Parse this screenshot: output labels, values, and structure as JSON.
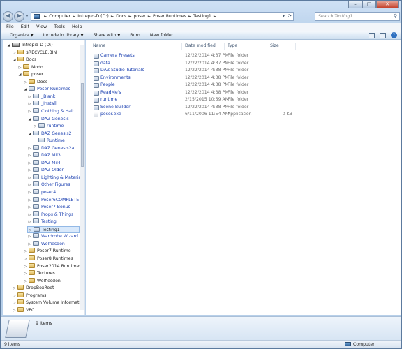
{
  "address": {
    "crumbs": [
      "Computer",
      "Intrepid-D (D:)",
      "Docs",
      "poser",
      "Poser Runtimes",
      "Testing1"
    ]
  },
  "search": {
    "placeholder": "Search Testing1"
  },
  "menu": [
    "File",
    "Edit",
    "View",
    "Tools",
    "Help"
  ],
  "toolbar": {
    "organize": "Organize",
    "include": "Include in library",
    "share": "Share with",
    "burn": "Burn",
    "new_folder": "New folder"
  },
  "tree": [
    {
      "label": "Intrepid-D (D:)",
      "level": 0,
      "arrow": "open",
      "icon": "drive"
    },
    {
      "label": "$RECYCLE.BIN",
      "level": 1,
      "arrow": "closed",
      "icon": "folder"
    },
    {
      "label": "Docs",
      "level": 1,
      "arrow": "open",
      "icon": "folder"
    },
    {
      "label": "Modo",
      "level": 2,
      "arrow": "closed",
      "icon": "folder"
    },
    {
      "label": "poser",
      "level": 2,
      "arrow": "open",
      "icon": "folder"
    },
    {
      "label": "Docs",
      "level": 3,
      "arrow": "closed",
      "icon": "folder"
    },
    {
      "label": "Poser Runtimes",
      "level": 3,
      "arrow": "open",
      "icon": "poser",
      "blue": true
    },
    {
      "label": "_Blank",
      "level": 4,
      "arrow": "closed",
      "icon": "poser",
      "blue": true
    },
    {
      "label": "_Install",
      "level": 4,
      "arrow": "closed",
      "icon": "poser",
      "blue": true
    },
    {
      "label": "Clothing & Hair",
      "level": 4,
      "arrow": "closed",
      "icon": "poser",
      "blue": true
    },
    {
      "label": "DAZ Genesis",
      "level": 4,
      "arrow": "open",
      "icon": "poser",
      "blue": true
    },
    {
      "label": "runtime",
      "level": 5,
      "arrow": "closed",
      "icon": "poser",
      "blue": true
    },
    {
      "label": "DAZ Genesis2",
      "level": 4,
      "arrow": "open",
      "icon": "poser",
      "blue": true
    },
    {
      "label": "Runtime",
      "level": 5,
      "arrow": "none",
      "icon": "poser",
      "blue": true
    },
    {
      "label": "DAZ Genesis2a",
      "level": 4,
      "arrow": "closed",
      "icon": "poser",
      "blue": true
    },
    {
      "label": "DAZ Mil3",
      "level": 4,
      "arrow": "closed",
      "icon": "poser",
      "blue": true
    },
    {
      "label": "DAZ Mil4",
      "level": 4,
      "arrow": "closed",
      "icon": "poser",
      "blue": true
    },
    {
      "label": "DAZ Older",
      "level": 4,
      "arrow": "closed",
      "icon": "poser",
      "blue": true
    },
    {
      "label": "Lighting & Materials",
      "level": 4,
      "arrow": "closed",
      "icon": "poser",
      "blue": true
    },
    {
      "label": "Other Figures",
      "level": 4,
      "arrow": "closed",
      "icon": "poser",
      "blue": true
    },
    {
      "label": "poser4",
      "level": 4,
      "arrow": "closed",
      "icon": "poser",
      "blue": true
    },
    {
      "label": "Poser6COMPLETE",
      "level": 4,
      "arrow": "closed",
      "icon": "poser",
      "blue": true
    },
    {
      "label": "Poser7 Bonus",
      "level": 4,
      "arrow": "closed",
      "icon": "poser",
      "blue": true
    },
    {
      "label": "Props & Things",
      "level": 4,
      "arrow": "closed",
      "icon": "poser",
      "blue": true
    },
    {
      "label": "Testing",
      "level": 4,
      "arrow": "closed",
      "icon": "poser",
      "blue": true
    },
    {
      "label": "Testing1",
      "level": 4,
      "arrow": "closed",
      "icon": "poser",
      "selected": true
    },
    {
      "label": "Wardrobe Wizard",
      "level": 4,
      "arrow": "closed",
      "icon": "poser",
      "blue": true
    },
    {
      "label": "Wolfiesden",
      "level": 4,
      "arrow": "closed",
      "icon": "poser",
      "blue": true
    },
    {
      "label": "Poser7 Runtime",
      "level": 3,
      "arrow": "closed",
      "icon": "folder"
    },
    {
      "label": "Poser8 Runtimes",
      "level": 3,
      "arrow": "closed",
      "icon": "folder"
    },
    {
      "label": "Poser2014 Runtimes",
      "level": 3,
      "arrow": "closed",
      "icon": "folder"
    },
    {
      "label": "Textures",
      "level": 3,
      "arrow": "closed",
      "icon": "folder"
    },
    {
      "label": "Wolfiesden",
      "level": 3,
      "arrow": "closed",
      "icon": "folder"
    },
    {
      "label": "DropBoxRoot",
      "level": 1,
      "arrow": "closed",
      "icon": "folder"
    },
    {
      "label": "Programs",
      "level": 1,
      "arrow": "closed",
      "icon": "folder"
    },
    {
      "label": "System Volume Information",
      "level": 1,
      "arrow": "closed",
      "icon": "folder"
    },
    {
      "label": "VPC",
      "level": 1,
      "arrow": "closed",
      "icon": "folder"
    }
  ],
  "columns": {
    "name": "Name",
    "date": "Date modified",
    "type": "Type",
    "size": "Size"
  },
  "files": [
    {
      "name": "Camera Presets",
      "date": "12/22/2014 4:37 PM",
      "type": "File folder",
      "size": "",
      "icon": "folder"
    },
    {
      "name": "data",
      "date": "12/22/2014 4:37 PM",
      "type": "File folder",
      "size": "",
      "icon": "folder"
    },
    {
      "name": "DAZ Studio Tutorials",
      "date": "12/22/2014 4:38 PM",
      "type": "File folder",
      "size": "",
      "icon": "folder"
    },
    {
      "name": "Environments",
      "date": "12/22/2014 4:38 PM",
      "type": "File folder",
      "size": "",
      "icon": "folder"
    },
    {
      "name": "People",
      "date": "12/22/2014 4:38 PM",
      "type": "File folder",
      "size": "",
      "icon": "folder"
    },
    {
      "name": "ReadMe's",
      "date": "12/22/2014 4:38 PM",
      "type": "File folder",
      "size": "",
      "icon": "folder"
    },
    {
      "name": "runtime",
      "date": "2/15/2015 10:59 AM",
      "type": "File folder",
      "size": "",
      "icon": "folder"
    },
    {
      "name": "Scene Builder",
      "date": "12/22/2014 4:38 PM",
      "type": "File folder",
      "size": "",
      "icon": "folder"
    },
    {
      "name": "poser.exe",
      "date": "6/11/2006 11:54 AM",
      "type": "Application",
      "size": "0 KB",
      "icon": "app"
    }
  ],
  "details": {
    "count": "9 items"
  },
  "status": {
    "items": "9 items",
    "location": "Computer"
  }
}
